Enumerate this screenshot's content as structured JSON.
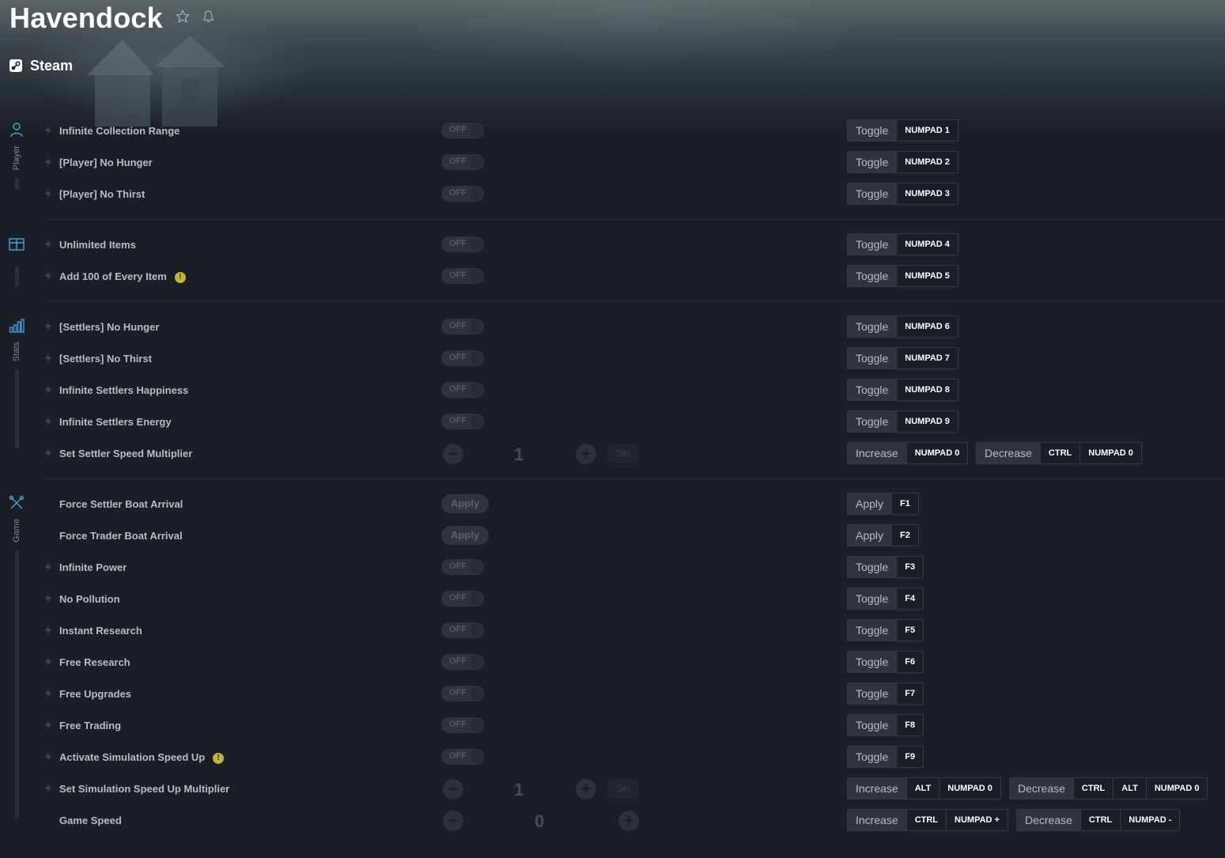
{
  "game": {
    "title": "Havendock",
    "platform": "Steam"
  },
  "categories": [
    {
      "label": "Player"
    },
    {
      "label": ""
    },
    {
      "label": "Stats"
    },
    {
      "label": "Game"
    }
  ],
  "rows": [
    {
      "name": "Infinite Collection Range",
      "control": "OFF",
      "hotkeys": [
        {
          "action": "Toggle",
          "keys": [
            "NUMPAD 1"
          ]
        }
      ]
    },
    {
      "name": "[Player] No Hunger",
      "control": "OFF",
      "hotkeys": [
        {
          "action": "Toggle",
          "keys": [
            "NUMPAD 2"
          ]
        }
      ]
    },
    {
      "name": "[Player] No Thirst",
      "control": "OFF",
      "hotkeys": [
        {
          "action": "Toggle",
          "keys": [
            "NUMPAD 3"
          ]
        }
      ]
    },
    {
      "name": "Unlimited Items",
      "control": "OFF",
      "hotkeys": [
        {
          "action": "Toggle",
          "keys": [
            "NUMPAD 4"
          ]
        }
      ]
    },
    {
      "name": "Add 100 of Every Item",
      "control": "OFF",
      "warning": "!",
      "hotkeys": [
        {
          "action": "Toggle",
          "keys": [
            "NUMPAD 5"
          ]
        }
      ]
    },
    {
      "name": "[Settlers] No Hunger",
      "control": "OFF",
      "hotkeys": [
        {
          "action": "Toggle",
          "keys": [
            "NUMPAD 6"
          ]
        }
      ]
    },
    {
      "name": "[Settlers] No Thirst",
      "control": "OFF",
      "hotkeys": [
        {
          "action": "Toggle",
          "keys": [
            "NUMPAD 7"
          ]
        }
      ]
    },
    {
      "name": "Infinite Settlers Happiness",
      "control": "OFF",
      "hotkeys": [
        {
          "action": "Toggle",
          "keys": [
            "NUMPAD 8"
          ]
        }
      ]
    },
    {
      "name": "Infinite Settlers Energy",
      "control": "OFF",
      "hotkeys": [
        {
          "action": "Toggle",
          "keys": [
            "NUMPAD 9"
          ]
        }
      ]
    },
    {
      "name": "Set Settler Speed Multiplier",
      "value": "1",
      "set_label": "Set",
      "hotkeys": [
        {
          "action": "Increase",
          "keys": [
            "NUMPAD 0"
          ]
        },
        {
          "action": "Decrease",
          "keys": [
            "CTRL",
            "NUMPAD 0"
          ]
        }
      ]
    },
    {
      "name": "Force Settler Boat Arrival",
      "control": "Apply",
      "hotkeys": [
        {
          "action": "Apply",
          "keys": [
            "F1"
          ]
        }
      ]
    },
    {
      "name": "Force Trader Boat Arrival",
      "control": "Apply",
      "hotkeys": [
        {
          "action": "Apply",
          "keys": [
            "F2"
          ]
        }
      ]
    },
    {
      "name": "Infinite Power",
      "control": "OFF",
      "hotkeys": [
        {
          "action": "Toggle",
          "keys": [
            "F3"
          ]
        }
      ]
    },
    {
      "name": "No Pollution",
      "control": "OFF",
      "hotkeys": [
        {
          "action": "Toggle",
          "keys": [
            "F4"
          ]
        }
      ]
    },
    {
      "name": "Instant Research",
      "control": "OFF",
      "hotkeys": [
        {
          "action": "Toggle",
          "keys": [
            "F5"
          ]
        }
      ]
    },
    {
      "name": "Free Research",
      "control": "OFF",
      "hotkeys": [
        {
          "action": "Toggle",
          "keys": [
            "F6"
          ]
        }
      ]
    },
    {
      "name": "Free Upgrades",
      "control": "OFF",
      "hotkeys": [
        {
          "action": "Toggle",
          "keys": [
            "F7"
          ]
        }
      ]
    },
    {
      "name": "Free Trading",
      "control": "OFF",
      "hotkeys": [
        {
          "action": "Toggle",
          "keys": [
            "F8"
          ]
        }
      ]
    },
    {
      "name": "Activate Simulation Speed Up",
      "control": "OFF",
      "warning": "!",
      "hotkeys": [
        {
          "action": "Toggle",
          "keys": [
            "F9"
          ]
        }
      ]
    },
    {
      "name": "Set Simulation Speed Up Multiplier",
      "value": "1",
      "set_label": "Set",
      "hotkeys": [
        {
          "action": "Increase",
          "keys": [
            "ALT",
            "NUMPAD 0"
          ]
        },
        {
          "action": "Decrease",
          "keys": [
            "CTRL",
            "ALT",
            "NUMPAD 0"
          ]
        }
      ]
    },
    {
      "name": "Game Speed",
      "value": "0",
      "hotkeys": [
        {
          "action": "Increase",
          "keys": [
            "CTRL",
            "NUMPAD +"
          ]
        },
        {
          "action": "Decrease",
          "keys": [
            "CTRL",
            "NUMPAD -"
          ]
        }
      ]
    }
  ],
  "colors": {
    "background": "#1a1e27",
    "warning": "#c7b43b",
    "accent": "#4aa3d8"
  }
}
